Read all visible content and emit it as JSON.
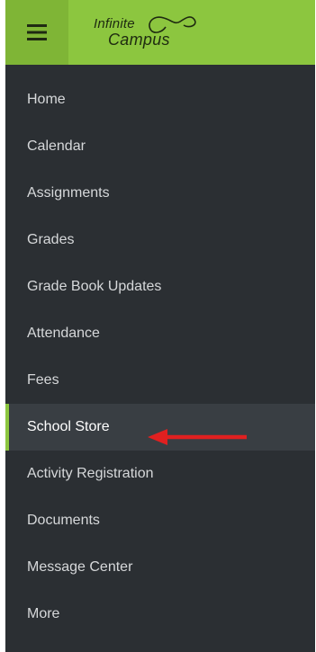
{
  "header": {
    "menu_icon": "hamburger-menu-icon",
    "logo_line1": "Infinite",
    "logo_line2": "Campus",
    "brand_color": "#8cc63f"
  },
  "nav": {
    "items": [
      {
        "label": "Home"
      },
      {
        "label": "Calendar"
      },
      {
        "label": "Assignments"
      },
      {
        "label": "Grades"
      },
      {
        "label": "Grade Book Updates"
      },
      {
        "label": "Attendance"
      },
      {
        "label": "Fees"
      },
      {
        "label": "School Store",
        "active": true
      },
      {
        "label": "Activity Registration"
      },
      {
        "label": "Documents"
      },
      {
        "label": "Message Center"
      },
      {
        "label": "More"
      }
    ]
  },
  "annotation": {
    "icon": "red-arrow-icon",
    "color": "#e02020"
  }
}
